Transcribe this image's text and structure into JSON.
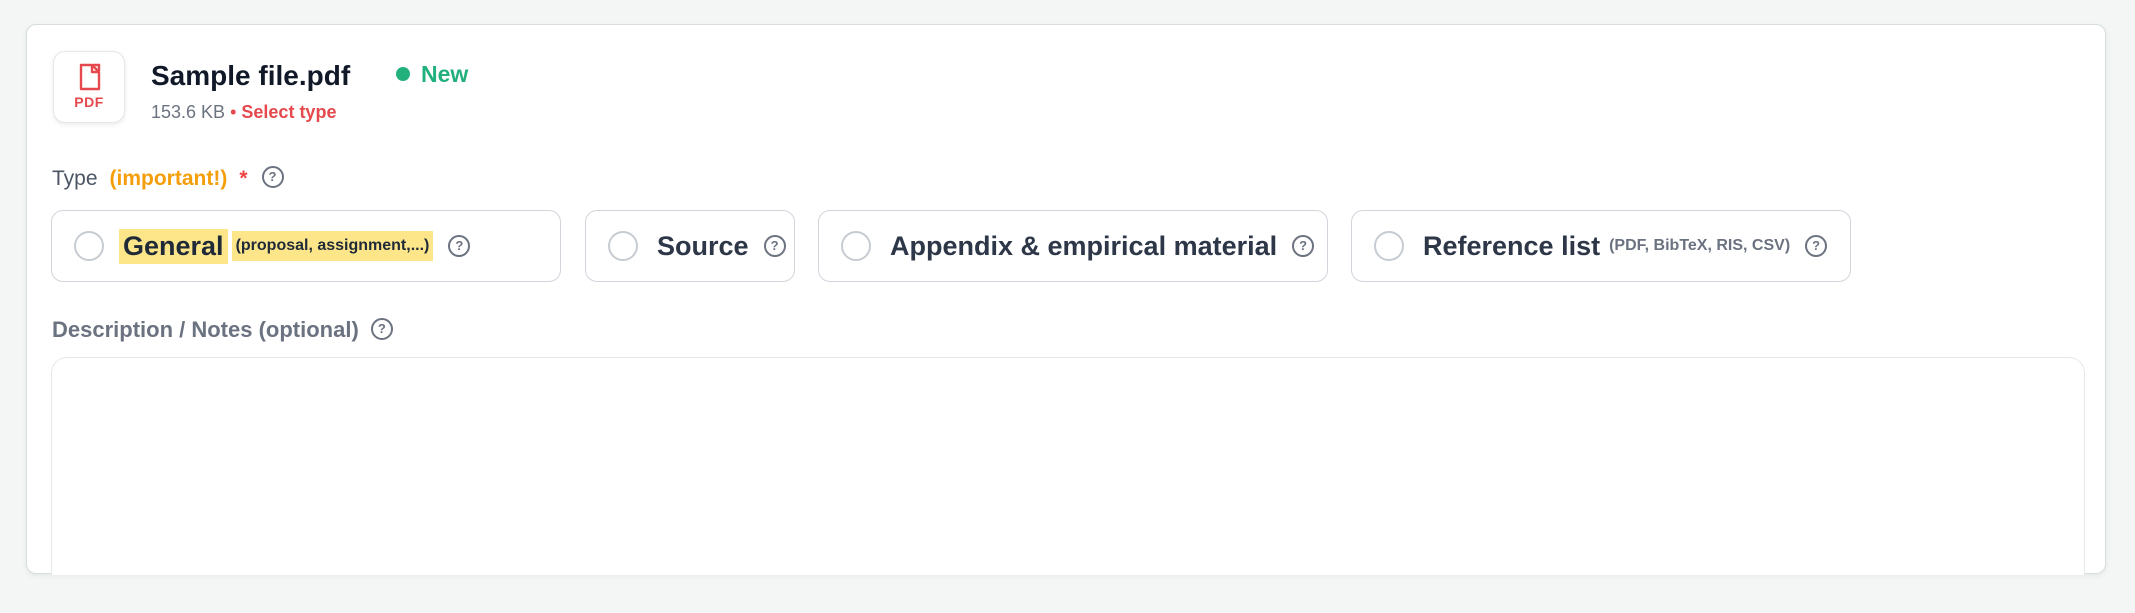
{
  "file": {
    "icon": "pdf-file-icon",
    "icon_label": "PDF",
    "name": "Sample file.pdf",
    "status": "New",
    "size": "153.6 KB",
    "separator": "•",
    "select_type": "Select type"
  },
  "type_field": {
    "label": "Type",
    "important": "(important!)",
    "required_mark": "*",
    "help_glyph": "?"
  },
  "type_options": [
    {
      "label": "General",
      "hint": "(proposal, assignment,...)",
      "help_glyph": "?"
    },
    {
      "label": "Source",
      "help_glyph": "?"
    },
    {
      "label": "Appendix & empirical material",
      "help_glyph": "?"
    },
    {
      "label": "Reference list",
      "hint": "(PDF, BibTeX, RIS, CSV)",
      "help_glyph": "?"
    }
  ],
  "description": {
    "label": "Description / Notes (optional)",
    "help_glyph": "?",
    "value": "",
    "placeholder": ""
  },
  "colors": {
    "status_green": "#22b07d",
    "error_red": "#e5484d",
    "important_orange": "#f59e0b",
    "highlight_yellow": "#fde68a"
  }
}
